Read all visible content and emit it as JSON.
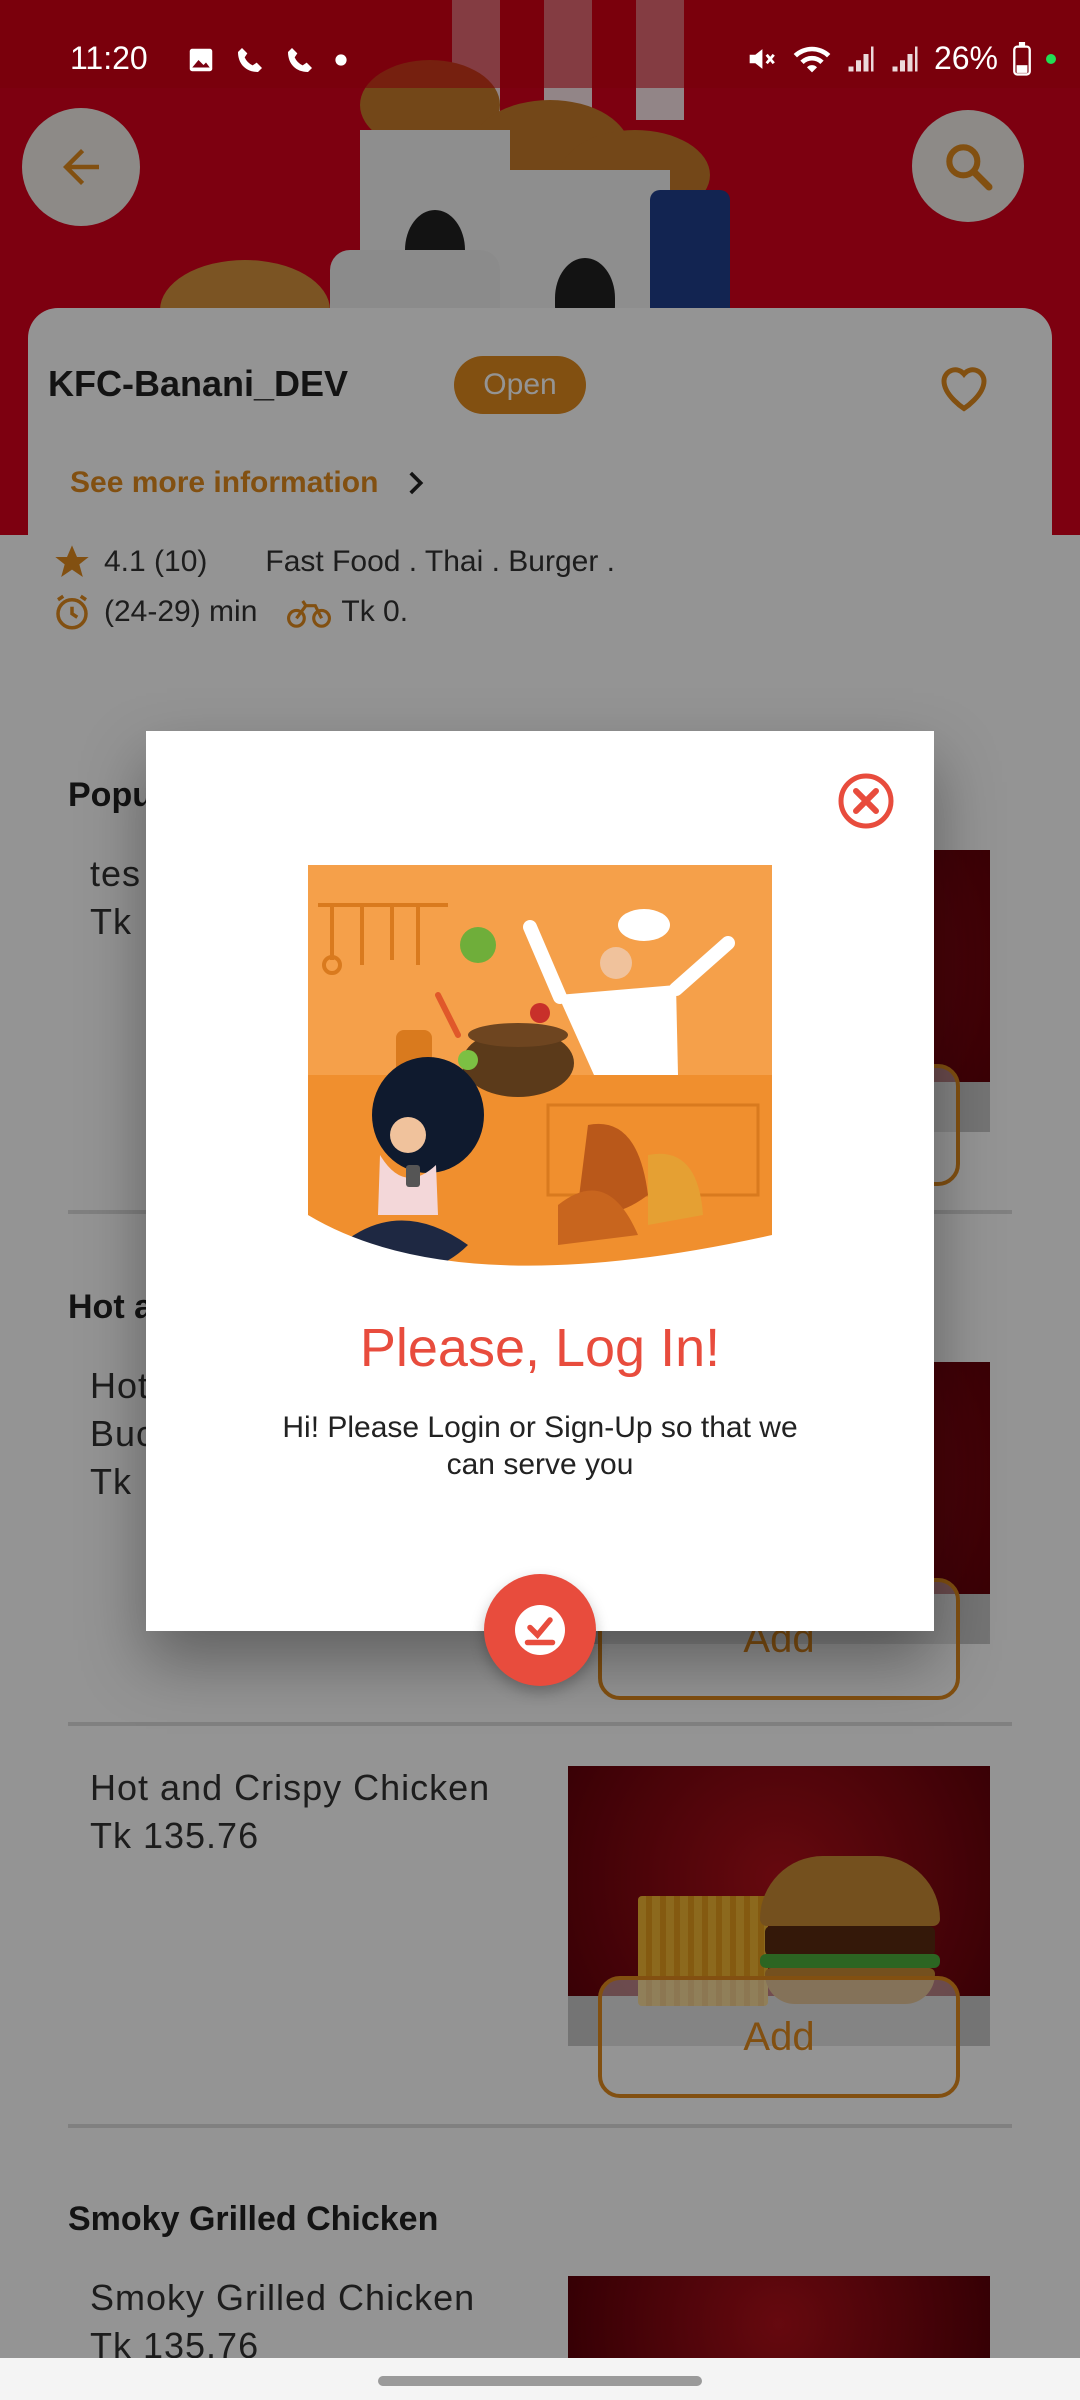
{
  "status_bar": {
    "time": "11:20",
    "battery": "26%",
    "left_icons": [
      "image-icon",
      "phone-icon",
      "phone-icon",
      "dot-icon"
    ],
    "right_icons": [
      "mute-icon",
      "wifi-icon",
      "signal-icon",
      "signal-icon",
      "battery-icon"
    ]
  },
  "header": {
    "back_icon": "arrow-left-icon",
    "search_icon": "search-icon"
  },
  "restaurant": {
    "name": "KFC-Banani_DEV",
    "status": "Open",
    "see_more": "See more information",
    "rating": "4.1 (10)",
    "cuisines": "Fast Food . Thai . Burger .",
    "delivery_time": "(24-29) min",
    "delivery_fee": "Tk 0."
  },
  "sections": [
    {
      "title": "Popu",
      "items": [
        {
          "name_line1": "tes",
          "price": "Tk"
        }
      ]
    },
    {
      "title": "Hot a",
      "items": [
        {
          "name_line1": "Hot",
          "name_line2": "Buc",
          "price": "Tk",
          "add_label": "Add"
        }
      ]
    },
    {
      "title": "",
      "items": [
        {
          "name_line1": "Hot and Crispy Chicken",
          "price": "Tk 135.76",
          "add_label": "Add"
        }
      ]
    },
    {
      "title": "Smoky Grilled Chicken",
      "items": [
        {
          "name_line1": "Smoky Grilled Chicken",
          "price": "Tk 135.76"
        }
      ]
    }
  ],
  "dialog": {
    "title": "Please, Log In!",
    "message": "Hi! Please Login or Sign-Up so that we can serve you",
    "close_icon": "close-circle-icon",
    "confirm_icon": "login-check-icon"
  },
  "colors": {
    "brand_red": "#d8001c",
    "accent_orange": "#e08a1e",
    "dialog_red": "#e84c3d"
  }
}
